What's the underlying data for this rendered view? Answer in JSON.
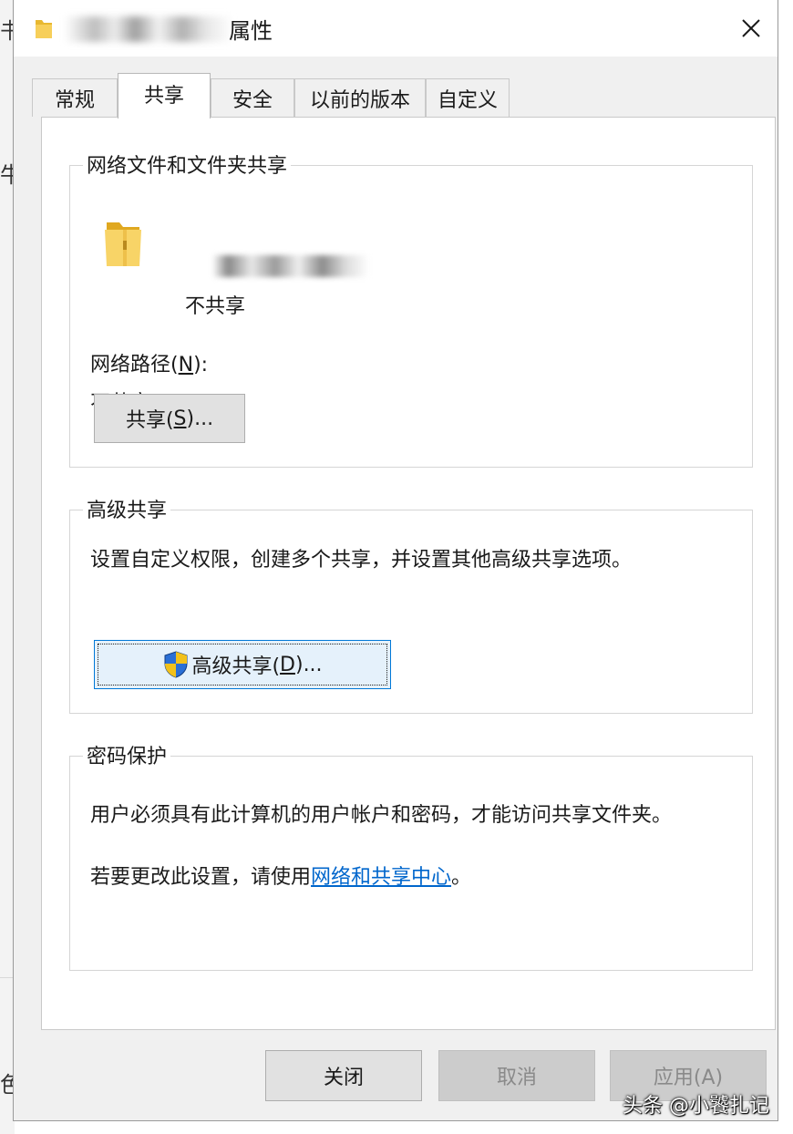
{
  "background": {
    "glyph_1": "书",
    "glyph_2": "牛",
    "glyph_3": "色"
  },
  "window": {
    "title_suffix": "属性",
    "close_icon": "close-icon"
  },
  "tabs": [
    {
      "label": "常规"
    },
    {
      "label": "共享",
      "active": true
    },
    {
      "label": "安全"
    },
    {
      "label": "以前的版本"
    },
    {
      "label": "自定义"
    }
  ],
  "network_sharing": {
    "legend": "网络文件和文件夹共享",
    "folder_icon": "folder-icon",
    "status": "不共享",
    "path_label": "网络路径",
    "path_hotkey": "N",
    "path_label_colon": ":",
    "path_value": "不共享",
    "share_button": {
      "prefix": "共享(",
      "hotkey": "S",
      "suffix": ")..."
    }
  },
  "advanced_sharing": {
    "legend": "高级共享",
    "description": "设置自定义权限，创建多个共享，并设置其他高级共享选项。",
    "shield_icon": "shield-icon",
    "button": {
      "prefix": "高级共享(",
      "hotkey": "D",
      "suffix": ")..."
    }
  },
  "password_protection": {
    "legend": "密码保护",
    "line1": "用户必须具有此计算机的用户帐户和密码，才能访问共享文件夹。",
    "line2_prefix": "若要更改此设置，请使用",
    "link_text": "网络和共享中心",
    "line2_suffix": "。"
  },
  "footer": {
    "close_label": "关闭",
    "cancel_label": "取消",
    "apply_label": "应用(A)"
  },
  "watermark": "头条 @小饕扎记"
}
